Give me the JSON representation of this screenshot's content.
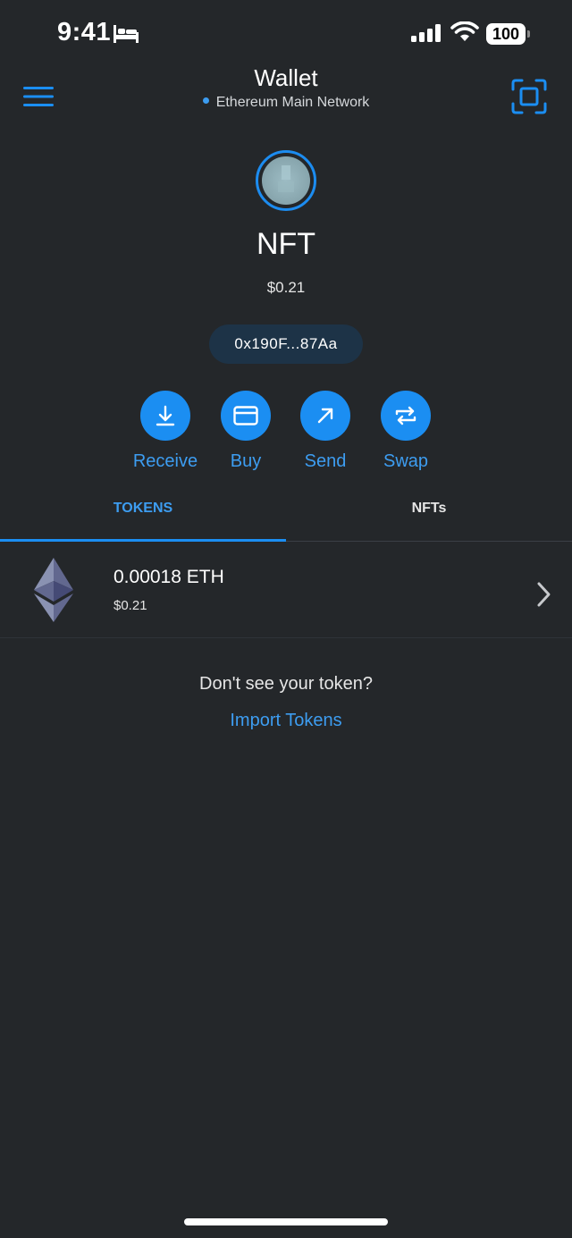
{
  "status_bar": {
    "time": "9:41",
    "battery": "100",
    "icons": [
      "bed-icon",
      "signal-icon",
      "wifi-icon",
      "battery-icon"
    ]
  },
  "navbar": {
    "title": "Wallet",
    "network": "Ethereum Main Network",
    "network_dot_color": "#3c9cf0",
    "left_icon": "menu-icon",
    "right_icon": "scan-icon"
  },
  "account": {
    "name": "NFT",
    "balance": "$0.21",
    "address": "0x190F...87Aa",
    "avatar_icon": "identicon-avatar"
  },
  "actions": [
    {
      "label": "Receive",
      "icon": "receive-icon"
    },
    {
      "label": "Buy",
      "icon": "card-icon"
    },
    {
      "label": "Send",
      "icon": "send-arrow-icon"
    },
    {
      "label": "Swap",
      "icon": "swap-icon"
    }
  ],
  "tabs": [
    {
      "label": "TOKENS",
      "active": true
    },
    {
      "label": "NFTs",
      "active": false
    }
  ],
  "tokens": [
    {
      "amount": "0.00018 ETH",
      "fiat": "$0.21",
      "icon": "eth-logo-icon"
    }
  ],
  "import": {
    "hint": "Don't see your token?",
    "link": "Import Tokens"
  },
  "colors": {
    "background": "#24272a",
    "accent": "#1b8ef2",
    "accent_text": "#3d9df1",
    "address_pill": "#1d3347"
  }
}
